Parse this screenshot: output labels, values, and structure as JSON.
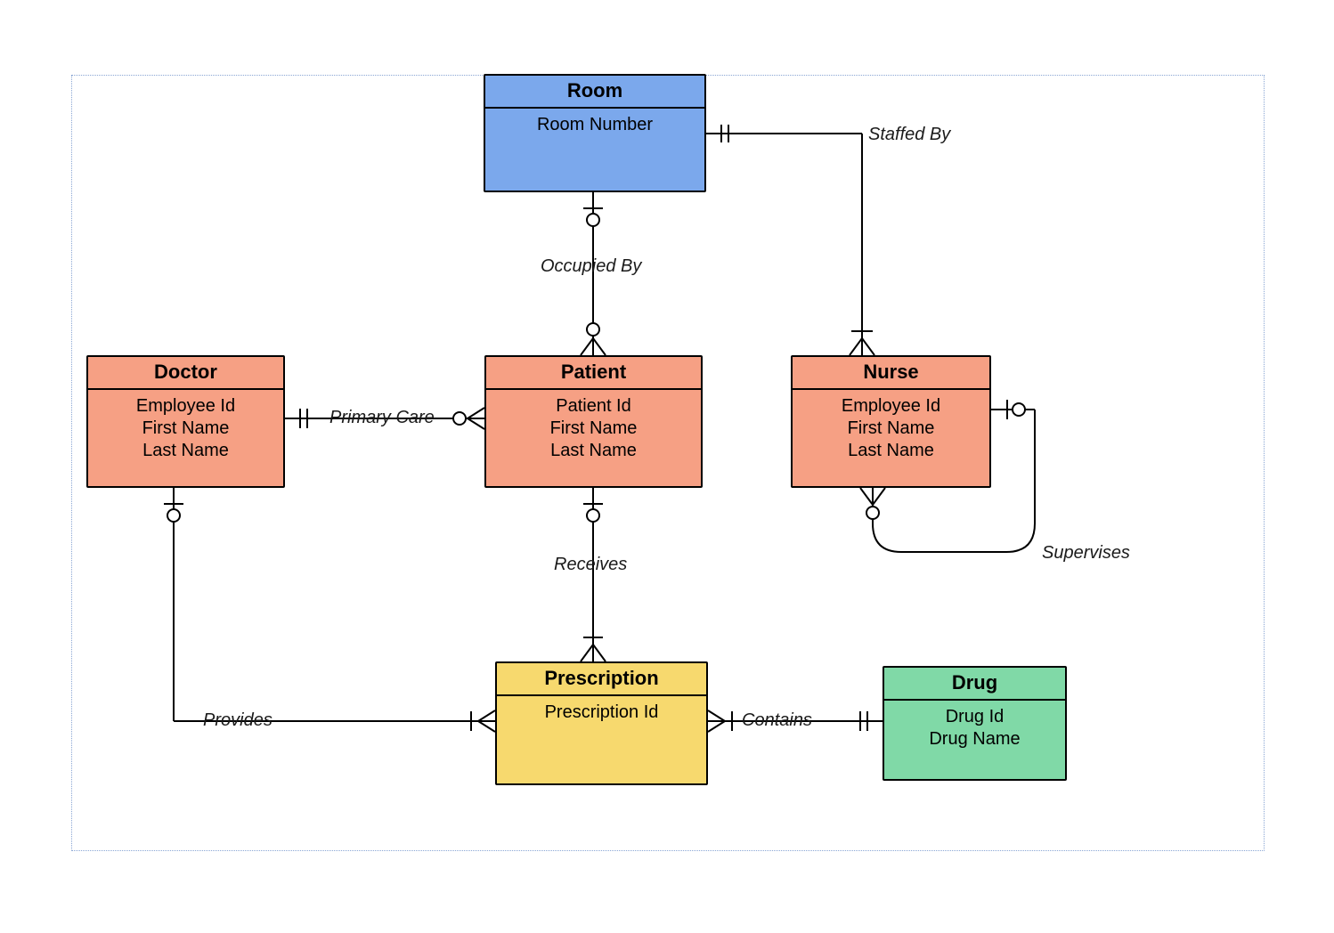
{
  "entities": {
    "room": {
      "title": "Room",
      "attrs": [
        "Room Number"
      ]
    },
    "doctor": {
      "title": "Doctor",
      "attrs": [
        "Employee Id",
        "First Name",
        "Last Name"
      ]
    },
    "patient": {
      "title": "Patient",
      "attrs": [
        "Patient Id",
        "First Name",
        "Last Name"
      ]
    },
    "nurse": {
      "title": "Nurse",
      "attrs": [
        "Employee Id",
        "First Name",
        "Last Name"
      ]
    },
    "prescription": {
      "title": "Prescription",
      "attrs": [
        "Prescription Id"
      ]
    },
    "drug": {
      "title": "Drug",
      "attrs": [
        "Drug Id",
        "Drug Name"
      ]
    }
  },
  "relationships": {
    "occupiedBy": "Occupied By",
    "staffedBy": "Staffed By",
    "primaryCare": "Primary Care",
    "receives": "Receives",
    "provides": "Provides",
    "contains": "Contains",
    "supervises": "Supervises"
  }
}
